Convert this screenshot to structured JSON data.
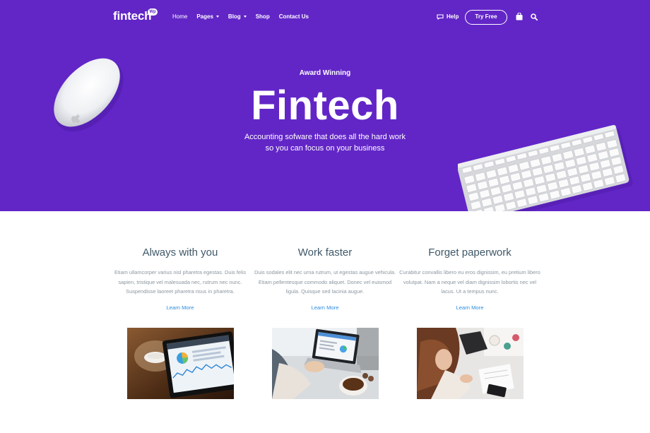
{
  "nav": {
    "logo": "fintech",
    "logo_badge": "Wp",
    "links": [
      {
        "label": "Home",
        "dropdown": false
      },
      {
        "label": "Pages",
        "dropdown": true
      },
      {
        "label": "Blog",
        "dropdown": true
      },
      {
        "label": "Shop",
        "dropdown": false
      },
      {
        "label": "Contact Us",
        "dropdown": false
      }
    ],
    "help_label": "Help",
    "cta_label": "Try Free",
    "icons": {
      "help": "chat-bubble-icon",
      "cart": "shopping-bag-icon",
      "search": "search-icon"
    }
  },
  "hero": {
    "eyebrow": "Award Winning",
    "title": "Fintech",
    "subtitle_line1": "Accounting sofware that does all the hard work",
    "subtitle_line2": "so you can focus on your business",
    "background_color": "#6226c7"
  },
  "features": [
    {
      "title": "Always with you",
      "text": "Etiam ullamcorper varius nisl pharetra egestas. Duis felis sapien, tristique vel malesuada nec, rutrum nec nunc. Suspendisse laoreet pharetra risus in pharetra.",
      "link": "Learn More"
    },
    {
      "title": "Work faster",
      "text": "Duis sodales elit nec urna rutrum, ut egestas augue vehicula. Etiam pellentesque commodo aliquet. Donec vel euismod ligula. Quisque sed lacinia augue.",
      "link": "Learn More"
    },
    {
      "title": "Forget paperwork",
      "text": "Curabitur convallis libero eu eros dignissim, eu pretium libero volutpat. Nam a neque vel diam dignissim lobortis nec vel lacus. Ut a tempus nunc.",
      "link": "Learn More"
    }
  ],
  "colors": {
    "accent": "#6226c7",
    "link": "#2b8de0",
    "heading": "#3f5868",
    "body_text": "#8c97a0"
  }
}
